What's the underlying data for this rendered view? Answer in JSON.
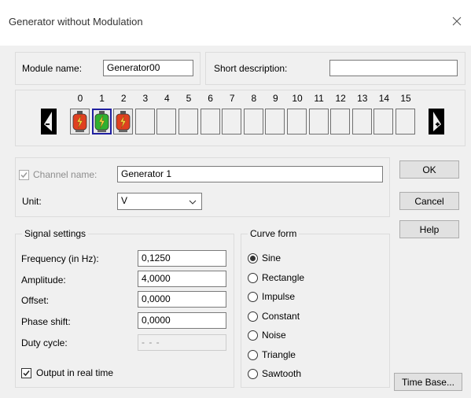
{
  "window": {
    "title": "Generator without Modulation",
    "close_icon": "close-icon"
  },
  "module": {
    "name_label": "Module name:",
    "name_value": "Generator00",
    "short_desc_label": "Short description:",
    "short_desc_value": ""
  },
  "channels": {
    "numbers": [
      "0",
      "1",
      "2",
      "3",
      "4",
      "5",
      "6",
      "7",
      "8",
      "9",
      "10",
      "11",
      "12",
      "13",
      "14",
      "15"
    ],
    "active": [
      {
        "index": 0,
        "color": "#e04020",
        "icon": "lightning-icon"
      },
      {
        "index": 1,
        "color": "#30b030",
        "icon": "lightning-icon"
      },
      {
        "index": 2,
        "color": "#e04020",
        "icon": "lightning-icon"
      }
    ],
    "selected_index": 1,
    "prev_icon": "arrow-left-icon",
    "next_icon": "arrow-right-icon"
  },
  "channel": {
    "name_label": "Channel name:",
    "name_value": "Generator 1",
    "name_checked": true,
    "unit_label": "Unit:",
    "unit_value": "V"
  },
  "buttons": {
    "ok": "OK",
    "cancel": "Cancel",
    "help": "Help",
    "time_base": "Time Base..."
  },
  "signal": {
    "group_label": "Signal settings",
    "frequency_label": "Frequency (in Hz):",
    "frequency_value": "0,1250",
    "amplitude_label": "Amplitude:",
    "amplitude_value": "4,0000",
    "offset_label": "Offset:",
    "offset_value": "0,0000",
    "phase_label": "Phase shift:",
    "phase_value": "0,0000",
    "duty_label": "Duty cycle:",
    "duty_value": "- - -",
    "realtime_label": "Output in real time",
    "realtime_checked": true
  },
  "curve": {
    "group_label": "Curve form",
    "options": [
      "Sine",
      "Rectangle",
      "Impulse",
      "Constant",
      "Noise",
      "Triangle",
      "Sawtooth"
    ],
    "selected": "Sine"
  }
}
